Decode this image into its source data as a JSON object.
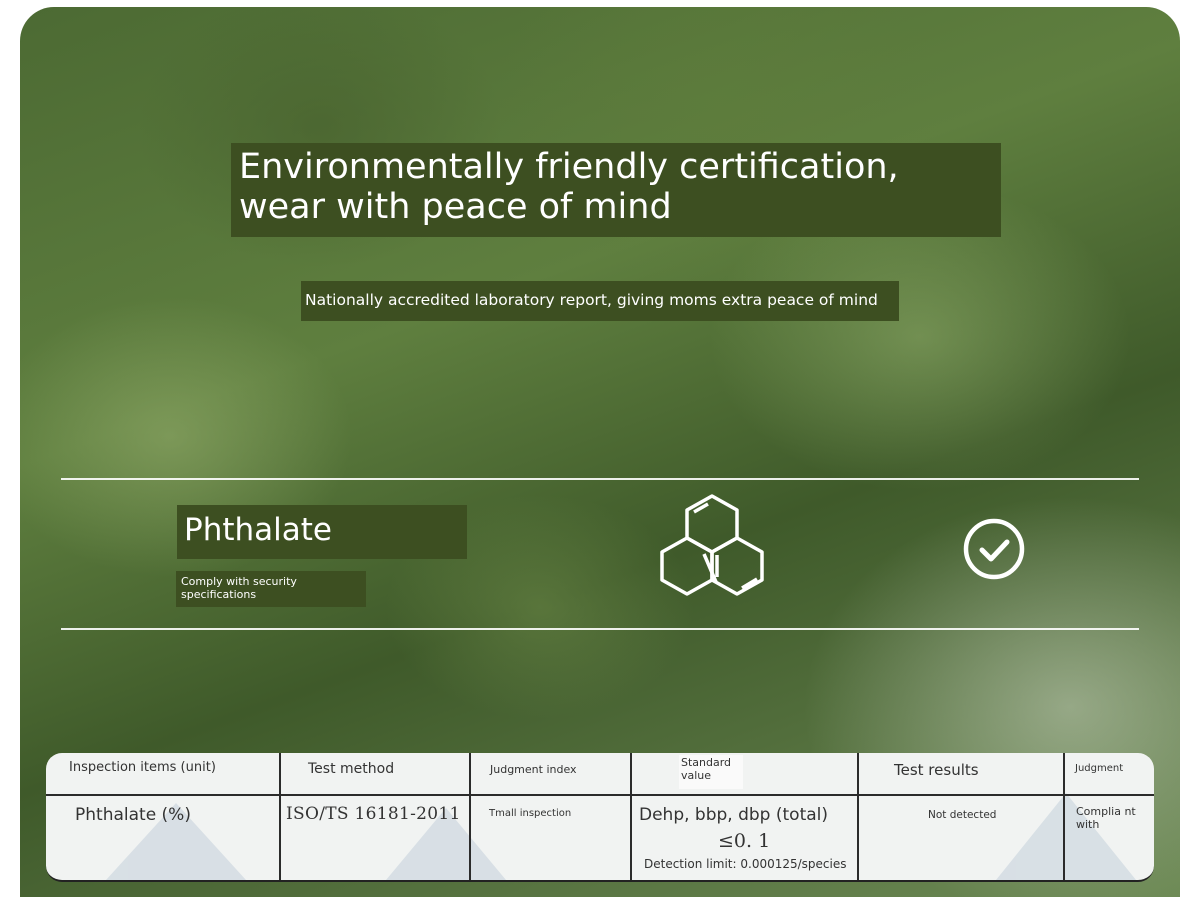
{
  "header": {
    "title": "Environmentally friendly certification, wear with peace of mind",
    "subtitle": "Nationally accredited laboratory report, giving moms extra peace of mind"
  },
  "feature": {
    "name": "Phthalate",
    "caption": "Comply with security specifications",
    "icons": [
      "molecule-hexagon-icon",
      "check-circle-icon"
    ]
  },
  "table": {
    "headers": [
      "Inspection items (unit)",
      "Test method",
      "Judgment index",
      "Standard value",
      "Test results",
      "Judgment"
    ],
    "row": {
      "item": "Phthalate (%)",
      "method": "ISO/TS 16181-2011",
      "index": "Tmall inspection",
      "standard_line1": "Dehp, bbp, dbp (total)",
      "standard_line2": "≤0. 1",
      "standard_line3": "Detection limit: 0.000125/species",
      "result": "Not detected",
      "judgment": "Complia nt with"
    }
  },
  "colors": {
    "band": "#3d4f21",
    "text_light": "#ffffff",
    "table_bg": "#f1f3f2",
    "grid": "#2b2b2b"
  }
}
